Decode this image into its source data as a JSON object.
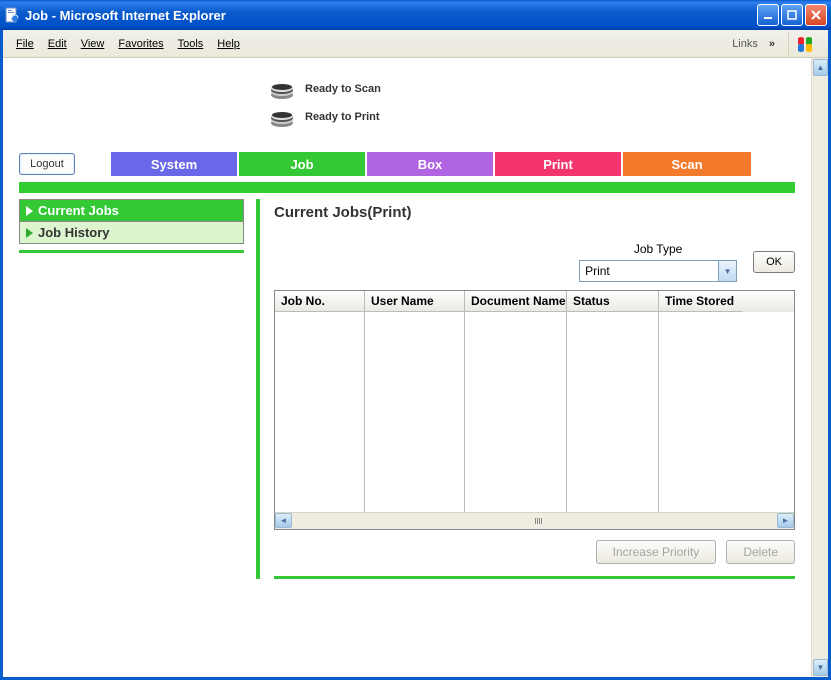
{
  "window": {
    "title": "Job - Microsoft Internet Explorer"
  },
  "menu": {
    "file": "File",
    "edit": "Edit",
    "view": "View",
    "favorites": "Favorites",
    "tools": "Tools",
    "help": "Help",
    "links": "Links"
  },
  "status": {
    "scan": "Ready to Scan",
    "print": "Ready to Print"
  },
  "buttons": {
    "logout": "Logout",
    "ok": "OK",
    "increase_priority": "Increase Priority",
    "delete": "Delete"
  },
  "tabs": {
    "system": {
      "label": "System",
      "color": "#6a67e8"
    },
    "job": {
      "label": "Job",
      "color": "#34c934"
    },
    "box": {
      "label": "Box",
      "color": "#b164e2"
    },
    "print": {
      "label": "Print",
      "color": "#f4356d"
    },
    "scan": {
      "label": "Scan",
      "color": "#f37a2a"
    }
  },
  "sidebar": {
    "items": [
      {
        "label": "Current Jobs",
        "active": true
      },
      {
        "label": "Job History",
        "active": false
      }
    ]
  },
  "pane": {
    "title": "Current Jobs(Print)"
  },
  "jobtype": {
    "label": "Job Type",
    "value": "Print"
  },
  "table": {
    "headers": [
      "Job No.",
      "User Name",
      "Document Name",
      "Status",
      "Time Stored"
    ]
  }
}
